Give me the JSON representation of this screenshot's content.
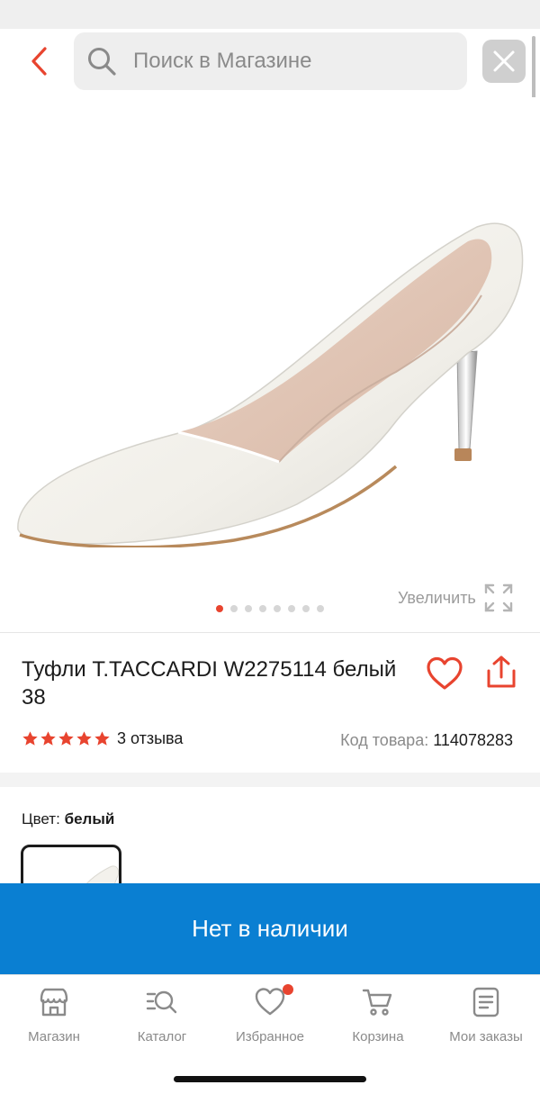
{
  "header": {
    "search_placeholder": "Поиск в Магазине"
  },
  "gallery": {
    "zoom_label": "Увеличить",
    "image_count": 8,
    "active_index": 0
  },
  "product": {
    "title": "Туфли T.TACCARDI W2275114 белый 38",
    "rating": 5,
    "reviews_label": "3 отзыва",
    "sku_label": "Код товара:",
    "sku_value": "114078283"
  },
  "color": {
    "label": "Цвет:",
    "value": "белый"
  },
  "cta": {
    "label": "Нет в наличии"
  },
  "nav": {
    "items": [
      {
        "label": "Магазин",
        "icon": "store-icon"
      },
      {
        "label": "Каталог",
        "icon": "catalog-search-icon"
      },
      {
        "label": "Избранное",
        "icon": "heart-icon",
        "badge": true
      },
      {
        "label": "Корзина",
        "icon": "cart-icon"
      },
      {
        "label": "Мои заказы",
        "icon": "orders-icon"
      }
    ]
  },
  "colors": {
    "accent": "#e8442f",
    "cta": "#0a7fd2",
    "muted": "#8a8a8a"
  }
}
